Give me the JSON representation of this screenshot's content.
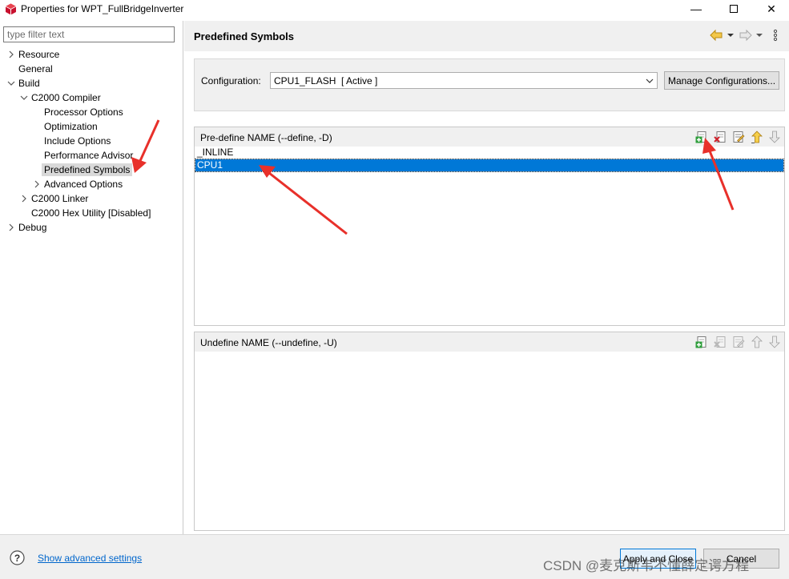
{
  "window": {
    "title": "Properties for WPT_FullBridgeInverter",
    "minimize_glyph": "—",
    "close_glyph": "✕"
  },
  "sidebar": {
    "filter_placeholder": "type filter text",
    "items": [
      {
        "label": "Resource",
        "level": 0,
        "expander": "collapsed"
      },
      {
        "label": "General",
        "level": 0,
        "expander": "none"
      },
      {
        "label": "Build",
        "level": 0,
        "expander": "expanded"
      },
      {
        "label": "C2000 Compiler",
        "level": 1,
        "expander": "expanded"
      },
      {
        "label": "Processor Options",
        "level": 2,
        "expander": "none"
      },
      {
        "label": "Optimization",
        "level": 2,
        "expander": "none"
      },
      {
        "label": "Include Options",
        "level": 2,
        "expander": "none"
      },
      {
        "label": "Performance Advisor",
        "level": 2,
        "expander": "none"
      },
      {
        "label": "Predefined Symbols",
        "level": 2,
        "expander": "none",
        "selected": true
      },
      {
        "label": "Advanced Options",
        "level": 2,
        "expander": "collapsed"
      },
      {
        "label": "C2000 Linker",
        "level": 1,
        "expander": "collapsed"
      },
      {
        "label": "C2000 Hex Utility  [Disabled]",
        "level": 1,
        "expander": "none"
      },
      {
        "label": "Debug",
        "level": 0,
        "expander": "collapsed"
      }
    ]
  },
  "page": {
    "title": "Predefined Symbols",
    "nav_icons": [
      "back-arrow-icon",
      "dropdown-icon",
      "forward-arrow-icon",
      "dropdown-icon",
      "more-vertical-icon"
    ]
  },
  "configuration": {
    "label": "Configuration:",
    "selected": "CPU1_FLASH  [ Active ]",
    "manage_label": "Manage Configurations..."
  },
  "define_panel": {
    "title": "Pre-define NAME (--define, -D)",
    "items": [
      "_INLINE",
      "CPU1"
    ],
    "selected_index": 1,
    "tools": [
      "add-icon",
      "delete-icon",
      "edit-icon",
      "move-up-icon",
      "move-down-icon"
    ]
  },
  "undefine_panel": {
    "title": "Undefine NAME (--undefine, -U)",
    "items": [],
    "tools": [
      "add-icon",
      "delete-icon",
      "edit-icon",
      "move-up-icon",
      "move-down-icon"
    ]
  },
  "footer": {
    "advanced_link": "Show advanced settings",
    "apply_label": "Apply and Close",
    "cancel_label": "Cancel",
    "watermark": "CSDN @麦克斯韦不懂薛定谔方程"
  },
  "colors": {
    "selection": "#0078d7",
    "annotation": "#e8302a",
    "link": "#0066cc",
    "panel_bg": "#f0f0f0"
  }
}
